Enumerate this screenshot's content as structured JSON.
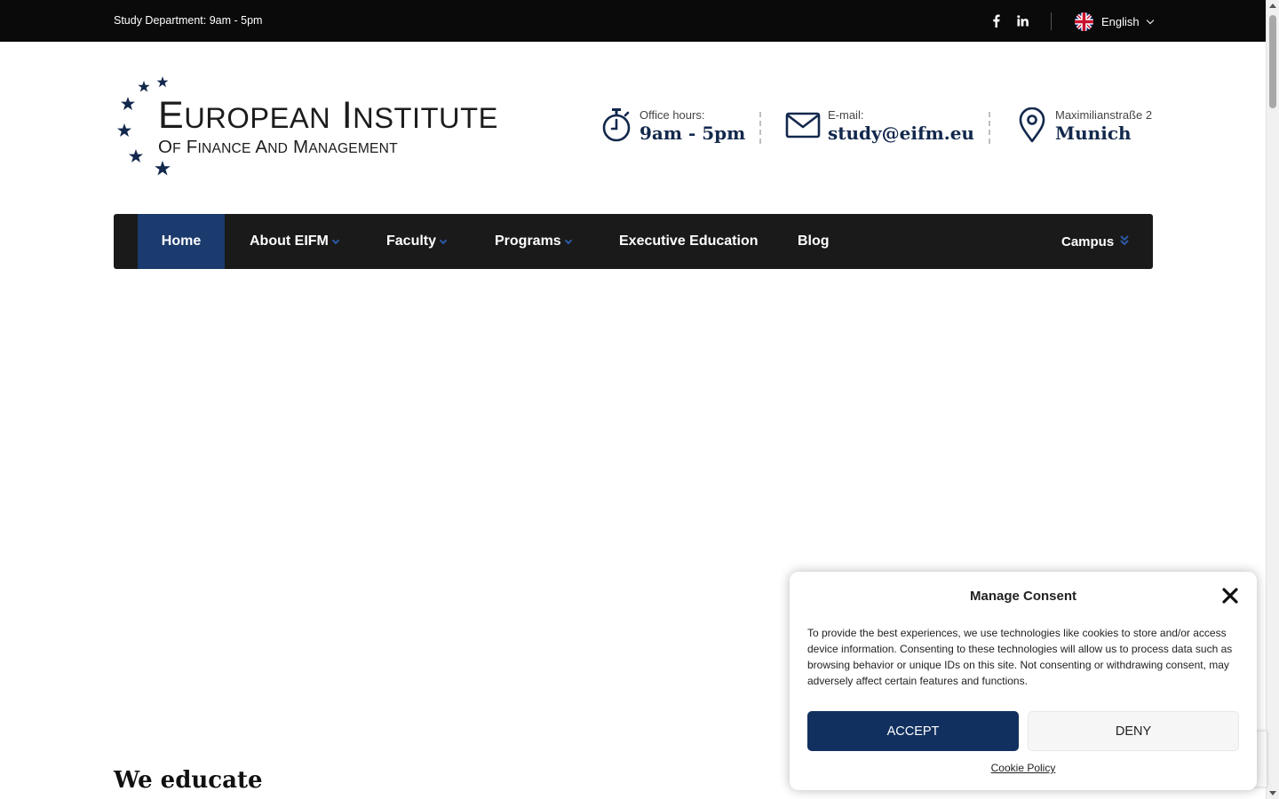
{
  "topbar": {
    "study_hours": "Study Department: 9am - 5pm",
    "social": [
      {
        "icon": "facebook-icon",
        "label": "f"
      },
      {
        "icon": "linkedin-icon",
        "label": "in"
      }
    ],
    "language": "English"
  },
  "logo": {
    "line1_first": "E",
    "line1_rest": "UROPEAN",
    "line1_first2": "I",
    "line1_rest2": "NSTITUTE",
    "line2": {
      "a1": "O",
      "a2": "F",
      "b1": "F",
      "b2": "INANCE",
      "c1": "A",
      "c2": "ND",
      "d1": "M",
      "d2": "ANAGEMENT"
    }
  },
  "contact": {
    "office": {
      "label": "Office hours:",
      "value": "9am - 5pm",
      "icon": "stopwatch-icon"
    },
    "email": {
      "label": "E-mail:",
      "value": "study@eifm.eu",
      "icon": "envelope-icon"
    },
    "address": {
      "label": "Maximilianstraße 2",
      "value": "Munich",
      "icon": "map-pin-icon"
    }
  },
  "nav": {
    "items": [
      {
        "label": "Home",
        "active": true
      },
      {
        "label": "About EIFM",
        "dropdown": true
      },
      {
        "label": "Faculty",
        "dropdown": true
      },
      {
        "label": "Programs",
        "dropdown": true
      },
      {
        "label": "Executive Education"
      },
      {
        "label": "Blog"
      }
    ],
    "campus": "Campus"
  },
  "hero": {
    "title": "We educate"
  },
  "consent": {
    "title": "Manage Consent",
    "message": "To provide the best experiences, we use technologies like cookies to store and/or access device information. Consenting to these technologies will allow us to process data such as browsing behavior or unique IDs on this site. Not consenting or withdrawing consent, may adversely affect certain features and functions.",
    "accept": "ACCEPT",
    "deny": "DENY",
    "policy": "Cookie Policy"
  },
  "colors": {
    "brand_navy": "#12284c",
    "nav_active": "#1b3a6d",
    "accept_bg": "#12305f",
    "topbar_bg": "#0a0a0a",
    "nav_bg": "#1a1a1a"
  }
}
